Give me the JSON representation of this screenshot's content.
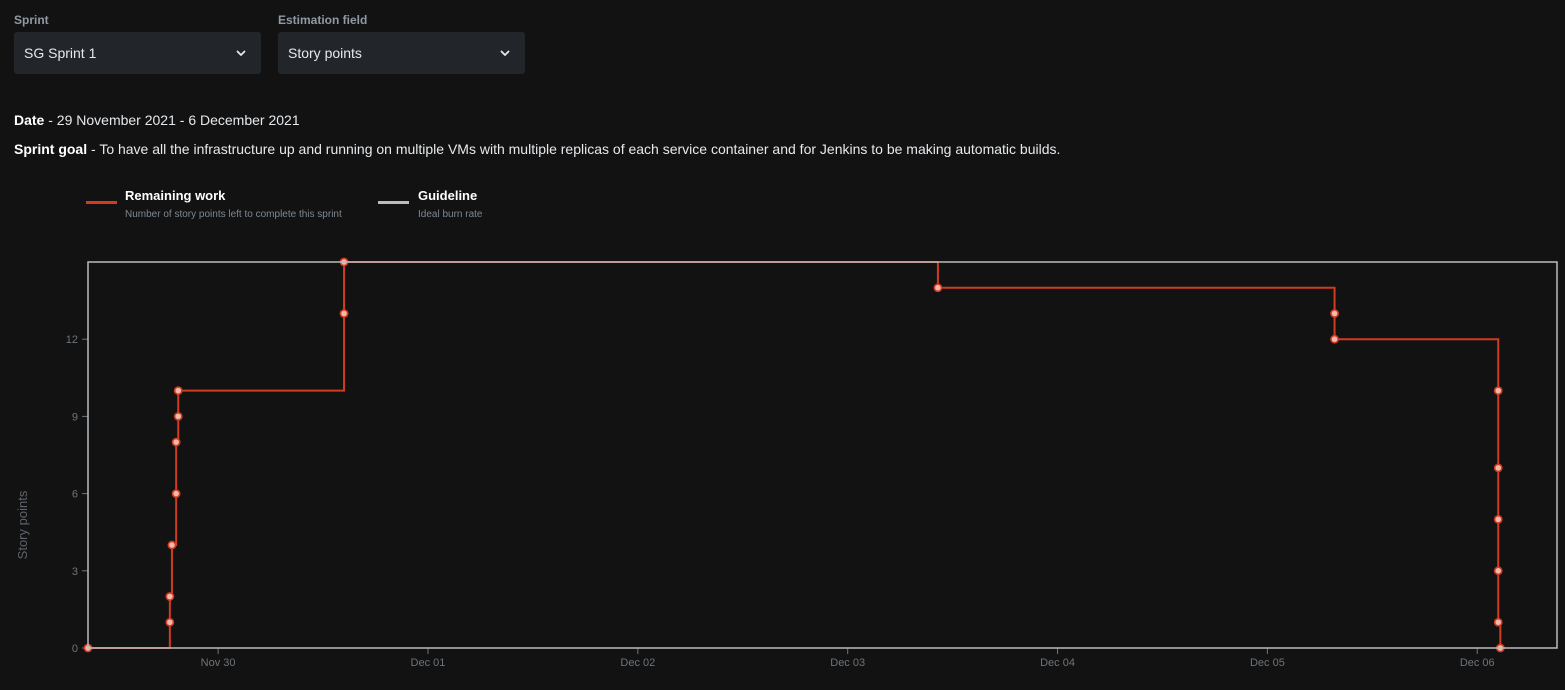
{
  "filters": {
    "sprint": {
      "label": "Sprint",
      "value": "SG Sprint 1"
    },
    "estimation": {
      "label": "Estimation field",
      "value": "Story points"
    }
  },
  "info": {
    "date_label": "Date",
    "date_value": " - 29 November 2021 - 6 December 2021",
    "goal_label": "Sprint goal",
    "goal_value": " - To have all the infrastructure up and running on multiple VMs with multiple replicas of each service container and for Jenkins to be making automatic builds."
  },
  "legend": {
    "remaining": {
      "title": "Remaining work",
      "subtitle": "Number of story points left to complete this sprint",
      "color": "#d13b20"
    },
    "guideline": {
      "title": "Guideline",
      "subtitle": "Ideal burn rate",
      "color": "#b8bcc0"
    }
  },
  "colors": {
    "background": "#121212",
    "frame": "#b8bcc0",
    "line": "#d13b20",
    "marker_fill": "#f3b8ad"
  },
  "chart_data": {
    "type": "line",
    "ylabel": "Story points",
    "xlabel": "",
    "x_tick_labels": [
      "Nov 30",
      "Dec 01",
      "Dec 02",
      "Dec 03",
      "Dec 04",
      "Dec 05",
      "Dec 06"
    ],
    "x_tick_days": [
      1,
      2,
      3,
      4,
      5,
      6,
      7
    ],
    "x_range_days": [
      0.38,
      7.38
    ],
    "y_ticks": [
      0,
      3,
      6,
      9,
      12
    ],
    "ylim": [
      0,
      15
    ],
    "series": [
      {
        "name": "Remaining work",
        "step": "after",
        "points": [
          {
            "x": 0.38,
            "y": 0,
            "marker": true
          },
          {
            "x": 0.77,
            "y": 1,
            "marker": true
          },
          {
            "x": 0.77,
            "y": 2,
            "marker": true
          },
          {
            "x": 0.78,
            "y": 4,
            "marker": true
          },
          {
            "x": 0.8,
            "y": 6,
            "marker": true
          },
          {
            "x": 0.8,
            "y": 8,
            "marker": true
          },
          {
            "x": 0.81,
            "y": 9,
            "marker": true
          },
          {
            "x": 0.81,
            "y": 10,
            "marker": true
          },
          {
            "x": 1.6,
            "y": 13,
            "marker": true
          },
          {
            "x": 1.6,
            "y": 15,
            "marker": true
          },
          {
            "x": 4.43,
            "y": 14,
            "marker": true
          },
          {
            "x": 6.32,
            "y": 13,
            "marker": true
          },
          {
            "x": 6.32,
            "y": 12,
            "marker": true
          },
          {
            "x": 7.1,
            "y": 10,
            "marker": true
          },
          {
            "x": 7.1,
            "y": 7,
            "marker": true
          },
          {
            "x": 7.1,
            "y": 5,
            "marker": true
          },
          {
            "x": 7.1,
            "y": 3,
            "marker": true
          },
          {
            "x": 7.1,
            "y": 1,
            "marker": true
          },
          {
            "x": 7.11,
            "y": 0,
            "marker": true
          }
        ]
      }
    ]
  }
}
